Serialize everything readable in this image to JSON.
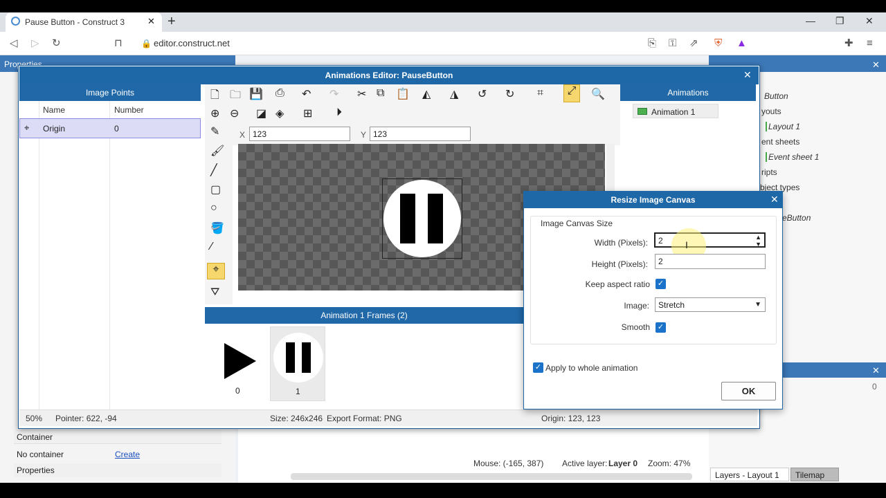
{
  "browser": {
    "tab_title": "Pause Button - Construct 3",
    "url": "editor.construct.net",
    "new_tab": "+",
    "win_min": "—",
    "win_max": "❐",
    "win_close": "✕"
  },
  "background": {
    "left_header": "Properties",
    "left_container_label": "Container",
    "left_no_container": "No container",
    "left_create_link": "Create",
    "left_properties": "Properties",
    "right_tree": [
      "Button",
      "youts",
      "Layout 1",
      "ent sheets",
      "Event sheet 1",
      "ripts",
      "bject types",
      "eButton"
    ],
    "right_layers": "Layers - Layout 1",
    "right_tilemap": "Tilemap",
    "right_zero": "0",
    "mouse": "Mouse: (-165, 387)",
    "active_layer_label": "Active layer:",
    "active_layer_value": "Layer 0",
    "zoom": "Zoom: 47%"
  },
  "anim_editor": {
    "title": "Animations Editor: PauseButton",
    "image_points_header": "Image Points",
    "col_name": "Name",
    "col_number": "Number",
    "origin_name": "Origin",
    "origin_number": "0",
    "x_label": "X",
    "x_value": "123",
    "y_label": "Y",
    "y_value": "123",
    "animations_header": "Animations",
    "animation_item": "Animation 1",
    "frames_header": "Animation 1 Frames (2)",
    "frames": [
      {
        "index": "0",
        "icon": "play-icon"
      },
      {
        "index": "1",
        "icon": "pause-icon"
      }
    ],
    "status_zoom": "50%",
    "status_pointer": "Pointer: 622, -94",
    "status_size": "Size: 246x246",
    "status_export": "Export Format: PNG",
    "status_origin": "Origin: 123, 123"
  },
  "dialog": {
    "title": "Resize Image Canvas",
    "group_label": "Image Canvas Size",
    "width_label": "Width (Pixels):",
    "width_value": "2",
    "height_label": "Height (Pixels):",
    "height_value": "2",
    "keep_aspect_label": "Keep aspect ratio",
    "keep_aspect_checked": true,
    "image_label": "Image:",
    "image_value": "Stretch",
    "smooth_label": "Smooth",
    "smooth_checked": true,
    "apply_label": "Apply to whole animation",
    "apply_checked": true,
    "ok_label": "OK"
  },
  "colors": {
    "accent": "#1f68a8",
    "checkbox": "#1a73c8",
    "highlight_row": "#dcdcf7",
    "active_tool": "#f5d76e"
  }
}
